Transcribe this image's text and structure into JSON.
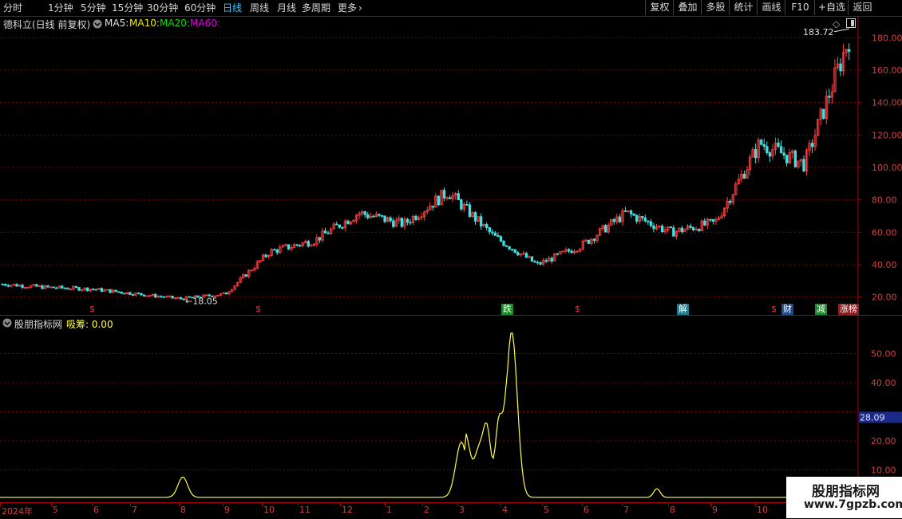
{
  "toolbar": {
    "periods": [
      "分时",
      "1分钟",
      "5分钟",
      "15分钟",
      "30分钟",
      "60分钟",
      "日线",
      "周线",
      "月线",
      "多周期",
      "更多"
    ],
    "active_period": "日线",
    "buttons": [
      "复权",
      "叠加",
      "多股",
      "统计",
      "画线",
      "F10",
      "+自选",
      "返回"
    ]
  },
  "main_panel": {
    "title": "德科立(日线 前复权)",
    "ma_labels": [
      {
        "text": "MA5:",
        "color": "#e0e0e0"
      },
      {
        "text": "MA10:",
        "color": "#e8e800"
      },
      {
        "text": "MA20:",
        "color": "#00e000"
      },
      {
        "text": "MA60:",
        "color": "#e000e0"
      }
    ],
    "high_label": "183.72",
    "low_label": "18.05",
    "y_ticks": [
      "180.00",
      "160.00",
      "140.00",
      "120.00",
      "100.00",
      "80.00",
      "60.00",
      "40.00",
      "20.00"
    ],
    "signals": [
      {
        "text": "$",
        "color": "#ff3030",
        "bg": "transparent"
      },
      {
        "text": "$",
        "color": "#ff3030",
        "bg": "transparent"
      },
      {
        "text": "跌",
        "color": "#ffffff",
        "bg": "#1d8a2a"
      },
      {
        "text": "$",
        "color": "#ff3030",
        "bg": "transparent"
      },
      {
        "text": "解",
        "color": "#ffffff",
        "bg": "#1d7a8a"
      },
      {
        "text": "$",
        "color": "#ff3030",
        "bg": "transparent"
      },
      {
        "text": "财",
        "color": "#ffffff",
        "bg": "#1d4a8a"
      },
      {
        "text": "减",
        "color": "#ffffff",
        "bg": "#1d8a2a"
      },
      {
        "text": "涨榜",
        "color": "#ffffff",
        "bg": "#8a1d1d"
      }
    ]
  },
  "indicator_panel": {
    "title": "股朋指标网",
    "series_label": "吸筹: 0.00",
    "y_ticks": [
      "50.00",
      "40.00",
      "20.00",
      "10.00"
    ],
    "current_value": "28.09"
  },
  "date_axis": [
    "2024年",
    "5",
    "6",
    "7",
    "8",
    "9",
    "10",
    "11",
    "12",
    "1",
    "2",
    "3",
    "4",
    "5",
    "6",
    "7",
    "8",
    "9",
    "10"
  ],
  "watermark": {
    "line1": "股朋指标网",
    "line2": "www.7gpzb.com"
  },
  "colors": {
    "up": "#ff4040",
    "down": "#40e0e0",
    "grid": "#800000",
    "indicator": "#ffff40"
  },
  "chart_data": {
    "type": "candlestick",
    "title": "德科立(日线 前复权)",
    "ylim": [
      10,
      190
    ],
    "close_approx": [
      {
        "x": "2024-04",
        "y": 28
      },
      {
        "x": "2024-05",
        "y": 26
      },
      {
        "x": "2024-06",
        "y": 25
      },
      {
        "x": "2024-07",
        "y": 22
      },
      {
        "x": "2024-08",
        "y": 19
      },
      {
        "x": "2024-09",
        "y": 22
      },
      {
        "x": "2024-10",
        "y": 48
      },
      {
        "x": "2024-11",
        "y": 55
      },
      {
        "x": "2024-12",
        "y": 72
      },
      {
        "x": "2025-01",
        "y": 65
      },
      {
        "x": "2025-02",
        "y": 85
      },
      {
        "x": "2025-03",
        "y": 58
      },
      {
        "x": "2025-04",
        "y": 40
      },
      {
        "x": "2025-05",
        "y": 52
      },
      {
        "x": "2025-06",
        "y": 72
      },
      {
        "x": "2025-07",
        "y": 60
      },
      {
        "x": "2025-08",
        "y": 66
      },
      {
        "x": "2025-09",
        "y": 115
      },
      {
        "x": "2025-10",
        "y": 102
      },
      {
        "x": "2025-11",
        "y": 180
      }
    ],
    "indicator": {
      "name": "吸筹",
      "peaks": [
        {
          "x": "2024-08",
          "y": 7
        },
        {
          "x": "2025-03",
          "y": 19
        },
        {
          "x": "2025-03",
          "y": 14
        },
        {
          "x": "2025-04",
          "y": 18
        },
        {
          "x": "2025-04",
          "y": 57
        },
        {
          "x": "2025-07",
          "y": 3
        }
      ],
      "ylim": [
        0,
        60
      ]
    }
  }
}
